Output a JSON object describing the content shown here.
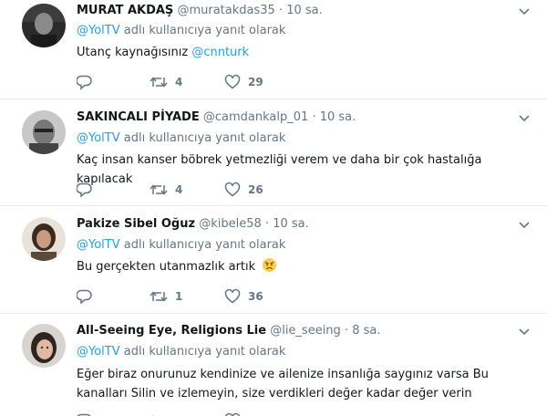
{
  "tweets": [
    {
      "name": "MURAT AKDAŞ",
      "handle": "@muratakdas35",
      "dot": "·",
      "time": "10 sa.",
      "reply_mention": "@YolTV",
      "reply_suffix": " adlı kullanıcıya yanıt olarak",
      "text": "Utanç kaynağısınız ",
      "text_mention": "@cnnturk",
      "replies": "",
      "retweets": "4",
      "likes": "29"
    },
    {
      "name": "SAKINCALI PİYADE",
      "handle": "@camdankalp_01",
      "dot": "·",
      "time": "10 sa.",
      "reply_mention": "@YolTV",
      "reply_suffix": " adlı kullanıcıya yanıt olarak",
      "text": "Kaç insan kanser böbrek yetmezliği verem ve daha bir çok hastalığa kapılacak",
      "replies": "",
      "retweets": "4",
      "likes": "26"
    },
    {
      "name": "Pakize Sibel Oğuz",
      "handle": "@kibele58",
      "dot": "·",
      "time": "10 sa.",
      "reply_mention": "@YolTV",
      "reply_suffix": " adlı kullanıcıya yanıt olarak",
      "text": "Bu gerçekten utanmazlık artık",
      "emoji": "angry-face-icon",
      "replies": "",
      "retweets": "1",
      "likes": "36"
    },
    {
      "name": "All-Seeing Eye, Religions Lie",
      "handle": "@lie_seeing",
      "dot": "·",
      "time": "8 sa.",
      "reply_mention": "@YolTV",
      "reply_suffix": " adlı kullanıcıya yanıt olarak",
      "text": "Eğer biraz onurunuz kendinize ve ailenize insanlığa saygınız varsa Bu kanalları Silin ve izlemeyin, size verdikleri değer kadar değer verin"
    }
  ],
  "colors": {
    "link": "#1da1f2",
    "muted": "#657786",
    "text": "#14171a",
    "divider": "#e6ecf0"
  }
}
